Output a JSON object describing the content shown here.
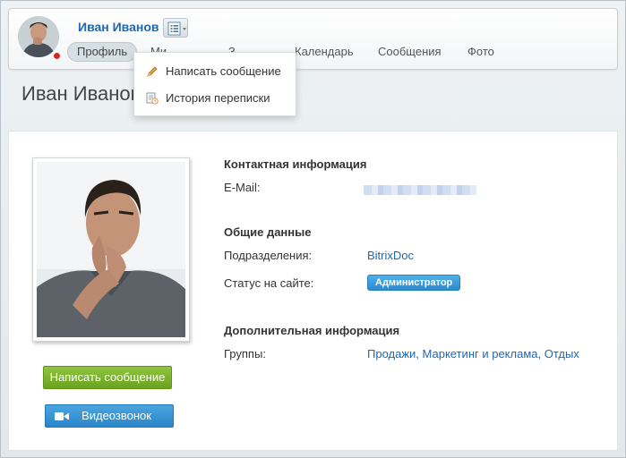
{
  "header": {
    "user_name": "Иван Иванов",
    "status_color": "#e0251b",
    "nav": [
      {
        "label": "Профиль",
        "active": true
      },
      {
        "label": "Ми..."
      },
      {
        "label": "З..."
      },
      {
        "label": "Календарь"
      },
      {
        "label": "Сообщения"
      },
      {
        "label": "Фото"
      }
    ]
  },
  "dropdown": {
    "items": [
      {
        "label": "Написать сообщение",
        "icon": "pencil-icon"
      },
      {
        "label": "История переписки",
        "icon": "history-icon"
      }
    ]
  },
  "page_title": "Иван Иванов",
  "profile": {
    "contact_title": "Контактная информация",
    "email_label": "E-Mail:",
    "general_title": "Общие данные",
    "department_label": "Подразделения:",
    "department_value": "BitrixDoc",
    "status_label": "Статус на сайте:",
    "status_badge": "Администратор",
    "extra_title": "Дополнительная информация",
    "groups_label": "Группы:",
    "groups": [
      "Продажи",
      "Маркетинг и реклама",
      "Отдых"
    ]
  },
  "actions": {
    "message_button": "Написать сообщение",
    "video_button": "Видеозвонок"
  },
  "colors": {
    "link": "#2067b0",
    "button_green": "#79b12a",
    "button_blue": "#3396d6"
  }
}
